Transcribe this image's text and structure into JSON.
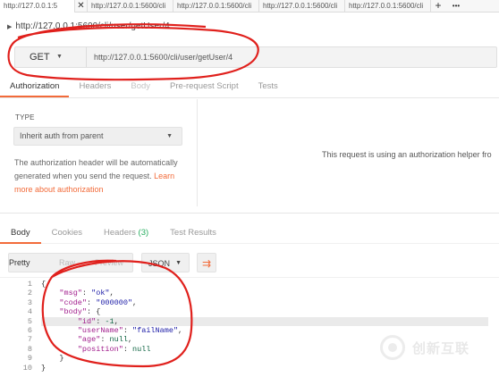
{
  "tabs": [
    {
      "label": "http://127.0.0.1:5",
      "active": true
    },
    {
      "label": "http://127.0.0.1:5600/cli"
    },
    {
      "label": "http://127.0.0.1:5600/cli"
    },
    {
      "label": "http://127.0.0.1:5600/cli"
    },
    {
      "label": "http://127.0.0.1:5600/cli"
    }
  ],
  "tab_close": "✕",
  "tab_add": "+",
  "tab_more": "•••",
  "breadcrumb": "http://127.0.0.1:5600/cli/user/getUser/4",
  "request": {
    "method": "GET",
    "url": "http://127.0.0.1:5600/cli/user/getUser/4"
  },
  "request_tabs": [
    "Authorization",
    "Headers",
    "Body",
    "Pre-request Script",
    "Tests"
  ],
  "auth": {
    "type_label": "TYPE",
    "type_value": "Inherit auth from parent",
    "description": "The authorization header will be automatically generated when you send the request.",
    "link": "Learn more about authorization",
    "helper": "This request is using an authorization helper fro"
  },
  "response_tabs": {
    "body": "Body",
    "cookies": "Cookies",
    "headers": "Headers",
    "headers_count": "(3)",
    "tests": "Test Results"
  },
  "view": {
    "pretty": "Pretty",
    "raw": "Raw",
    "preview": "Preview",
    "format": "JSON"
  },
  "code": {
    "line_numbers": [
      "1",
      "2",
      "3",
      "4",
      "5",
      "6",
      "7",
      "8",
      "9",
      "10"
    ],
    "lines": [
      "{",
      "    \"msg\": \"ok\",",
      "    \"code\": \"000000\",",
      "    \"body\": {",
      "        \"id\": -1,",
      "        \"userName\": \"failName\",",
      "        \"age\": null,",
      "        \"position\": null",
      "    }",
      "}"
    ],
    "highlight_line": 5
  },
  "watermark": "创新互联",
  "colors": {
    "accent": "#f26b3a",
    "annotation": "#e0201c",
    "count": "#27ae60"
  }
}
